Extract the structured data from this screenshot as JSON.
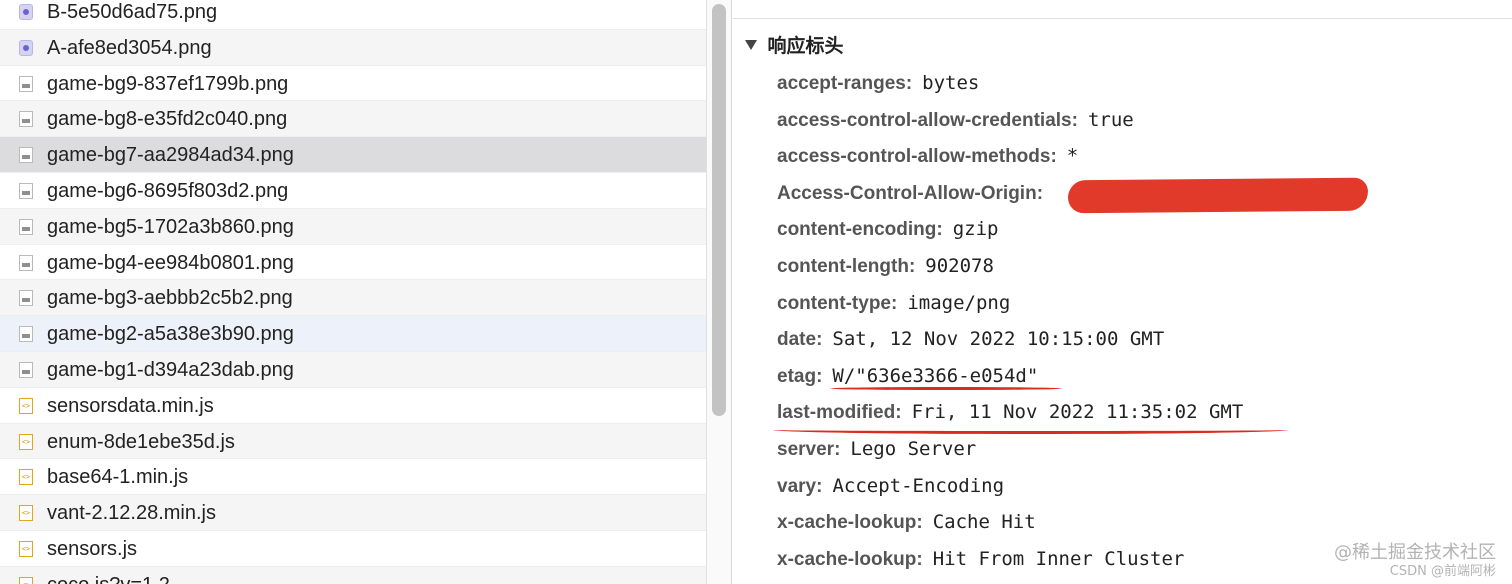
{
  "file_list": {
    "items": [
      {
        "name": "B-5e50d6ad75.png",
        "icon": "font-file-icon",
        "state": "normal"
      },
      {
        "name": "A-afe8ed3054.png",
        "icon": "font-file-icon",
        "state": "alt"
      },
      {
        "name": "game-bg9-837ef1799b.png",
        "icon": "image-file-icon",
        "state": "normal"
      },
      {
        "name": "game-bg8-e35fd2c040.png",
        "icon": "image-file-icon",
        "state": "alt"
      },
      {
        "name": "game-bg7-aa2984ad34.png",
        "icon": "image-file-icon",
        "state": "selected"
      },
      {
        "name": "game-bg6-8695f803d2.png",
        "icon": "image-file-icon",
        "state": "normal"
      },
      {
        "name": "game-bg5-1702a3b860.png",
        "icon": "image-file-icon",
        "state": "alt"
      },
      {
        "name": "game-bg4-ee984b0801.png",
        "icon": "image-file-icon",
        "state": "normal"
      },
      {
        "name": "game-bg3-aebbb2c5b2.png",
        "icon": "image-file-icon",
        "state": "alt"
      },
      {
        "name": "game-bg2-a5a38e3b90.png",
        "icon": "image-file-icon",
        "state": "hover"
      },
      {
        "name": "game-bg1-d394a23dab.png",
        "icon": "image-file-icon",
        "state": "alt"
      },
      {
        "name": "sensorsdata.min.js",
        "icon": "script-file-icon",
        "state": "normal"
      },
      {
        "name": "enum-8de1ebe35d.js",
        "icon": "script-file-icon",
        "state": "alt"
      },
      {
        "name": "base64-1.min.js",
        "icon": "script-file-icon",
        "state": "normal"
      },
      {
        "name": "vant-2.12.28.min.js",
        "icon": "script-file-icon",
        "state": "alt"
      },
      {
        "name": "sensors.js",
        "icon": "script-file-icon",
        "state": "normal"
      },
      {
        "name": "coco.js?v=1.2",
        "icon": "script-file-icon",
        "state": "alt"
      }
    ]
  },
  "headers_panel": {
    "section_title": "响应标头",
    "headers": [
      {
        "name": "accept-ranges",
        "value": "bytes"
      },
      {
        "name": "access-control-allow-credentials",
        "value": "true"
      },
      {
        "name": "access-control-allow-methods",
        "value": "*"
      },
      {
        "name": "Access-Control-Allow-Origin",
        "value": ""
      },
      {
        "name": "content-encoding",
        "value": "gzip"
      },
      {
        "name": "content-length",
        "value": "902078"
      },
      {
        "name": "content-type",
        "value": "image/png"
      },
      {
        "name": "date",
        "value": "Sat, 12 Nov 2022 10:15:00 GMT"
      },
      {
        "name": "etag",
        "value": "W/\"636e3366-e054d\""
      },
      {
        "name": "last-modified",
        "value": "Fri, 11 Nov 2022 11:35:02 GMT"
      },
      {
        "name": "server",
        "value": "Lego Server"
      },
      {
        "name": "vary",
        "value": "Accept-Encoding"
      },
      {
        "name": "x-cache-lookup",
        "value": "Cache Hit"
      },
      {
        "name": "x-cache-lookup",
        "value": "Hit From Inner Cluster"
      }
    ]
  },
  "watermark": {
    "line1": "@稀土掘金技术社区",
    "line2": "CSDN @前端阿彬"
  },
  "annotation_color": "#e13a2a"
}
